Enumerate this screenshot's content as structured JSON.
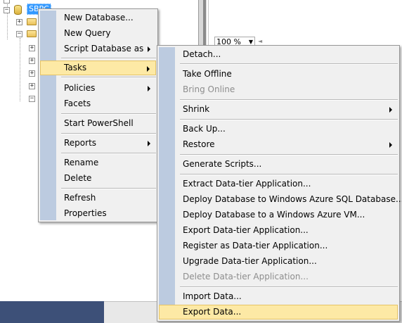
{
  "object_explorer": {
    "server_node_label": "SBPC",
    "zoom": {
      "value": "100 %"
    }
  },
  "context_menu": {
    "items": [
      {
        "label": "New Database..."
      },
      {
        "label": "New Query"
      },
      {
        "label": "Script Database as",
        "submenu": true
      },
      {
        "label": "Tasks",
        "submenu": true,
        "highlighted": true
      },
      {
        "label": "Policies",
        "submenu": true
      },
      {
        "label": "Facets"
      },
      {
        "label": "Start PowerShell"
      },
      {
        "label": "Reports",
        "submenu": true
      },
      {
        "label": "Rename"
      },
      {
        "label": "Delete"
      },
      {
        "label": "Refresh"
      },
      {
        "label": "Properties"
      }
    ]
  },
  "tasks_submenu": {
    "items": [
      {
        "label": "Detach..."
      },
      {
        "label": "Take Offline"
      },
      {
        "label": "Bring Online",
        "disabled": true
      },
      {
        "label": "Shrink",
        "submenu": true
      },
      {
        "label": "Back Up..."
      },
      {
        "label": "Restore",
        "submenu": true
      },
      {
        "label": "Generate Scripts..."
      },
      {
        "label": "Extract Data-tier Application..."
      },
      {
        "label": "Deploy Database to Windows Azure SQL Database..."
      },
      {
        "label": "Deploy Database to a Windows Azure VM..."
      },
      {
        "label": "Export Data-tier Application..."
      },
      {
        "label": "Register as Data-tier Application..."
      },
      {
        "label": "Upgrade Data-tier Application..."
      },
      {
        "label": "Delete Data-tier Application...",
        "disabled": true
      },
      {
        "label": "Import Data..."
      },
      {
        "label": "Export Data...",
        "highlighted": true
      }
    ]
  },
  "colors": {
    "menu_background": "#f0f0f0",
    "menu_gutter": "#bccbe0",
    "highlight_fill": "#fde9a5",
    "highlight_border": "#e5c365",
    "selected_node": "#3399ff",
    "status_bar": "#3d5078"
  }
}
